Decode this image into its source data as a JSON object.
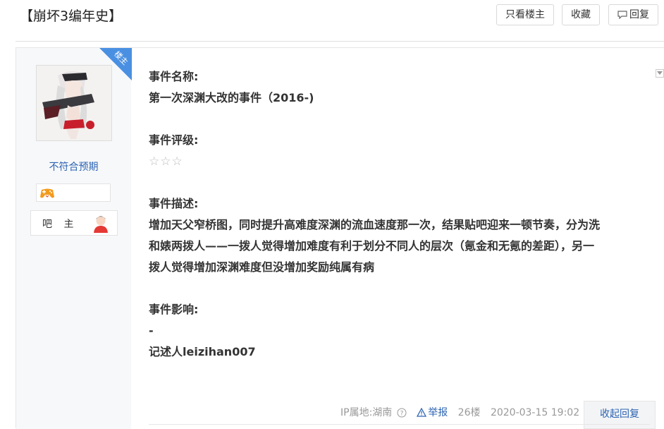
{
  "header": {
    "title": "【崩坏3编年史】",
    "only_author_label": "只看楼主",
    "favorite_label": "收藏",
    "reply_label": "回复"
  },
  "author": {
    "corner_badge": "楼主",
    "username": "不符合预期",
    "role": "吧 主",
    "level_icon": "gamepad-badge-icon",
    "role_icon": "user-avatar-icon"
  },
  "content": {
    "name_label": "事件名称:",
    "name_value": "第一次深渊大改的事件（2016-)",
    "rating_label": "事件评级:",
    "rating_stars": "☆☆☆",
    "rating_count": 3,
    "desc_label": "事件描述:",
    "desc_line1": "增加天父窄桥图，同时提升高难度深渊的流血速度那一次，结果贴吧迎来一顿节奏，分为洗",
    "desc_line2": "和婊两拨人——一拨人觉得增加难度有利于划分不同人的层次（氪金和无氪的差距），另一",
    "desc_line3": "拨人觉得增加深渊难度但没增加奖励纯属有病",
    "impact_label": "事件影响:",
    "impact_value": "-",
    "recorder": "记述人leizihan007"
  },
  "tail": {
    "ip": "IP属地:湖南",
    "report": "举报",
    "floor": "26楼",
    "time": "2020-03-15 19:02",
    "collapse_label": "收起回复"
  },
  "colors": {
    "accent": "#2d64b3",
    "corner": "#4a90e2"
  }
}
